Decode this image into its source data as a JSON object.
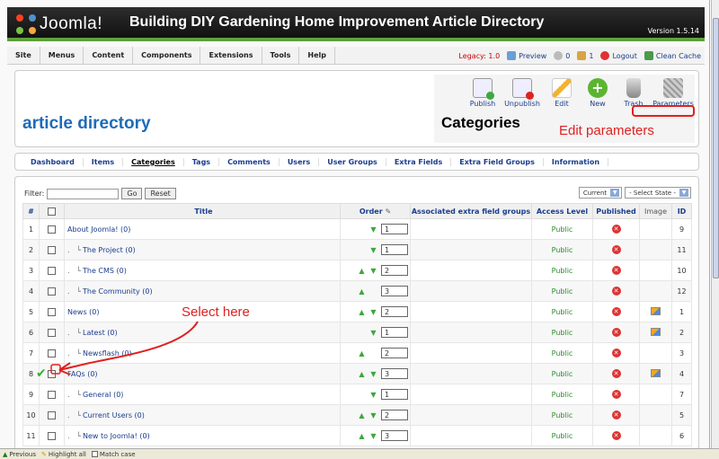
{
  "header": {
    "logo_text": "Joomla!",
    "site_title": "Building DIY Gardening Home Improvement Article Directory",
    "version": "Version 1.5.14"
  },
  "menu": [
    "Site",
    "Menus",
    "Content",
    "Components",
    "Extensions",
    "Tools",
    "Help"
  ],
  "status": {
    "legacy": "Legacy: 1.0",
    "preview": "Preview",
    "messages": "0",
    "users": "1",
    "logout": "Logout",
    "clean_cache": "Clean Cache"
  },
  "component_title": "article directory",
  "page_title": "Categories",
  "toolbar": {
    "publish": "Publish",
    "unpublish": "Unpublish",
    "edit": "Edit",
    "new": "New",
    "trash": "Trash",
    "parameters": "Parameters"
  },
  "annotations": {
    "edit_parameters": "Edit parameters",
    "select_here": "Select here",
    "annotation_color": "#e02020"
  },
  "submenu": [
    "Dashboard",
    "Items",
    "Categories",
    "Tags",
    "Comments",
    "Users",
    "User Groups",
    "Extra Fields",
    "Extra Field Groups",
    "Information"
  ],
  "filter": {
    "label": "Filter:",
    "value": "",
    "go": "Go",
    "reset": "Reset",
    "current": "Current",
    "select_state": "- Select State -"
  },
  "table": {
    "headers": [
      "#",
      "",
      "Title",
      "Order",
      "Associated extra field groups",
      "Access Level",
      "Published",
      "Image",
      "ID"
    ],
    "rows": [
      {
        "num": "1",
        "title": "About Joomla! (0)",
        "indent": 0,
        "up": false,
        "down": true,
        "order": "1",
        "access": "Public",
        "image": false,
        "id": "9"
      },
      {
        "num": "2",
        "title": "The Project (0)",
        "indent": 1,
        "up": false,
        "down": true,
        "order": "1",
        "access": "Public",
        "image": false,
        "id": "11"
      },
      {
        "num": "3",
        "title": "The CMS (0)",
        "indent": 1,
        "up": true,
        "down": true,
        "order": "2",
        "access": "Public",
        "image": false,
        "id": "10"
      },
      {
        "num": "4",
        "title": "The Community (0)",
        "indent": 1,
        "up": true,
        "down": false,
        "order": "3",
        "access": "Public",
        "image": false,
        "id": "12"
      },
      {
        "num": "5",
        "title": "News (0)",
        "indent": 0,
        "up": true,
        "down": true,
        "order": "2",
        "access": "Public",
        "image": true,
        "id": "1"
      },
      {
        "num": "6",
        "title": "Latest (0)",
        "indent": 1,
        "up": false,
        "down": true,
        "order": "1",
        "access": "Public",
        "image": true,
        "id": "2"
      },
      {
        "num": "7",
        "title": "Newsflash (0)",
        "indent": 1,
        "up": true,
        "down": false,
        "order": "2",
        "access": "Public",
        "image": false,
        "id": "3"
      },
      {
        "num": "8",
        "title": "FAQs (0)",
        "indent": 0,
        "up": true,
        "down": true,
        "order": "3",
        "access": "Public",
        "image": true,
        "id": "4"
      },
      {
        "num": "9",
        "title": "General (0)",
        "indent": 1,
        "up": false,
        "down": true,
        "order": "1",
        "access": "Public",
        "image": false,
        "id": "7"
      },
      {
        "num": "10",
        "title": "Current Users (0)",
        "indent": 1,
        "up": true,
        "down": true,
        "order": "2",
        "access": "Public",
        "image": false,
        "id": "5"
      },
      {
        "num": "11",
        "title": "New to Joomla! (0)",
        "indent": 1,
        "up": true,
        "down": true,
        "order": "3",
        "access": "Public",
        "image": false,
        "id": "6"
      }
    ]
  },
  "findbar": {
    "previous": "Previous",
    "highlight": "Highlight all",
    "match_case": "Match case"
  },
  "colors": {
    "header_bg": "#1a1a1a",
    "accent_green": "#5fa03c",
    "link_blue": "#1a3d8e",
    "title_blue": "#1e6bb8"
  }
}
